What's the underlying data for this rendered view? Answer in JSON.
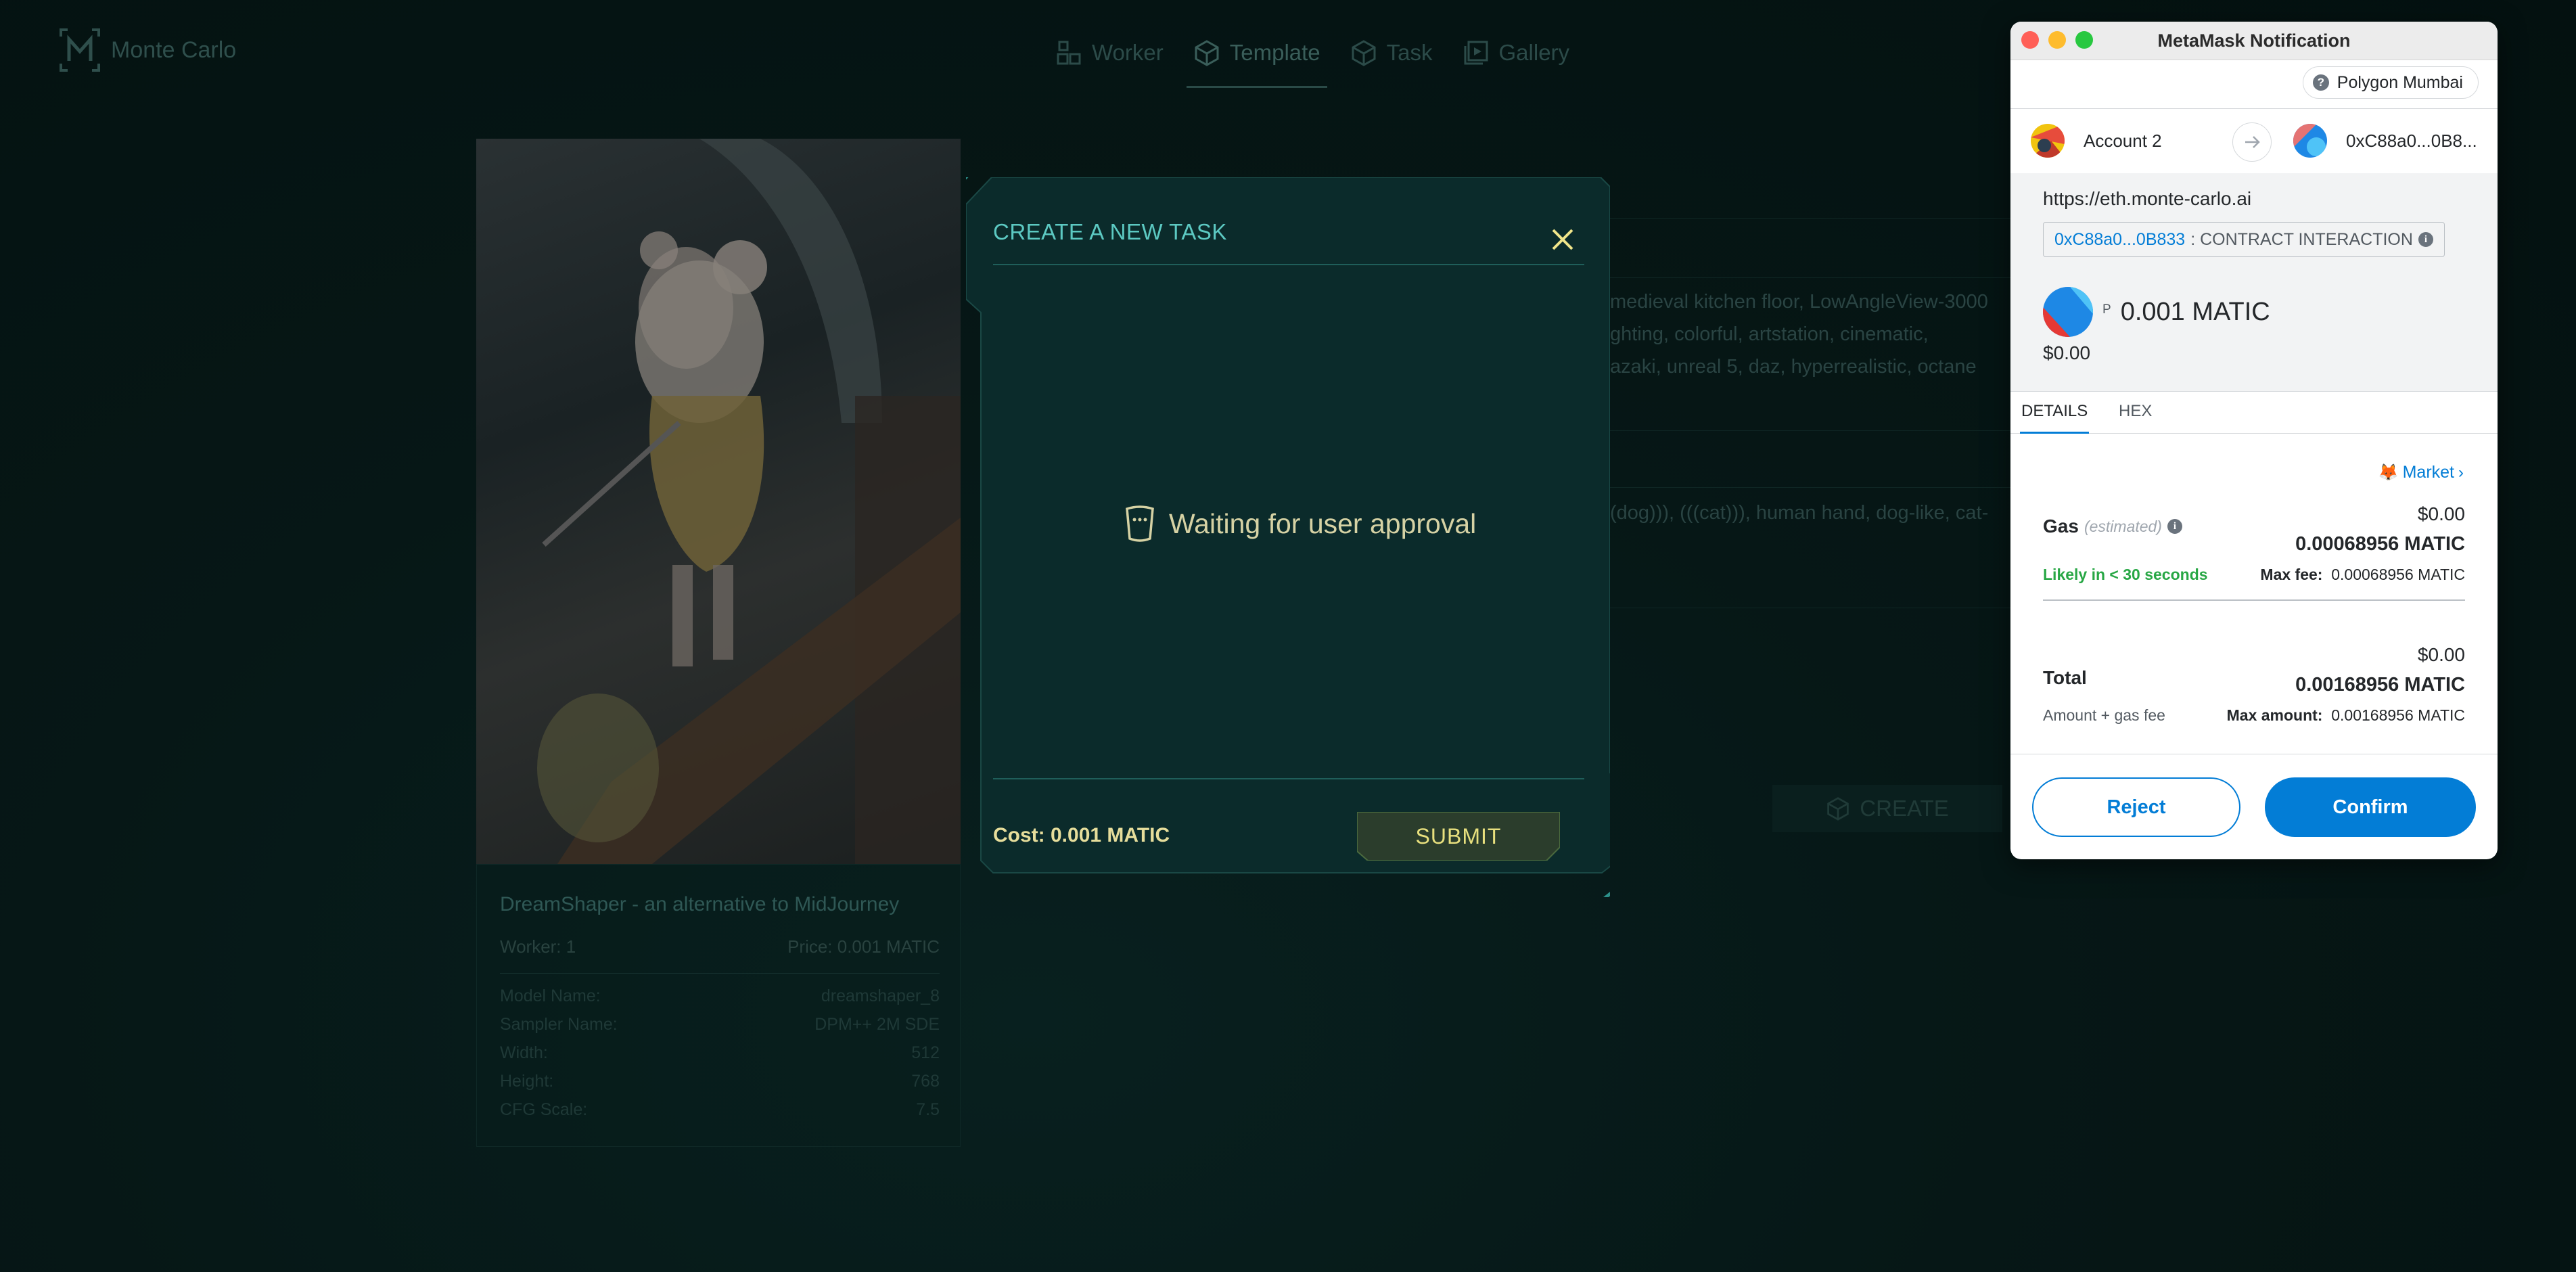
{
  "app": {
    "logo_text": "Monte Carlo",
    "nav": [
      {
        "label": "Worker",
        "icon": "worker-icon"
      },
      {
        "label": "Template",
        "icon": "cube-icon",
        "active": true
      },
      {
        "label": "Task",
        "icon": "cube-icon"
      },
      {
        "label": "Gallery",
        "icon": "gallery-icon"
      }
    ],
    "card": {
      "title": "DreamShaper - an alternative to MidJourney",
      "worker": "Worker: 1",
      "price": "Price: 0.001 MATIC",
      "specs": [
        {
          "label": "Model Name:",
          "value": "dreamshaper_8"
        },
        {
          "label": "Sampler Name:",
          "value": "DPM++ 2M SDE"
        },
        {
          "label": "Width:",
          "value": "512"
        },
        {
          "label": "Height:",
          "value": "768"
        },
        {
          "label": "CFG Scale:",
          "value": "7.5"
        }
      ]
    },
    "prompt_lines": [
      "medieval kitchen floor, LowAngleView-3000",
      "ghting, colorful, artstation, cinematic,",
      "azaki, unreal 5, daz, hyperrealistic, octane"
    ],
    "negative_line": "(dog))), (((cat))), human hand, dog-like, cat-",
    "create_label": "CREATE"
  },
  "modal": {
    "title": "CREATE A NEW TASK",
    "waiting_text": "Waiting for user approval",
    "cost": "Cost: 0.001 MATIC",
    "submit_label": "SUBMIT"
  },
  "metamask": {
    "window_title": "MetaMask Notification",
    "network": "Polygon Mumbai",
    "from_account": "Account 2",
    "to_account": "0xC88a0...0B8...",
    "origin": "https://eth.monte-carlo.ai",
    "contract_address": "0xC88a0...0B833",
    "contract_type": ": CONTRACT INTERACTION",
    "token_symbol_letter": "P",
    "amount": "0.001 MATIC",
    "amount_usd": "$0.00",
    "tabs": [
      "DETAILS",
      "HEX"
    ],
    "market_label": "Market",
    "gas": {
      "label": "Gas",
      "estimated": "(estimated)",
      "usd": "$0.00",
      "value": "0.00068956 MATIC",
      "likely": "Likely in < 30 seconds",
      "max_fee_label": "Max fee:",
      "max_fee_value": "0.00068956 MATIC"
    },
    "total": {
      "label": "Total",
      "usd": "$0.00",
      "value": "0.00168956 MATIC",
      "sub": "Amount + gas fee",
      "max_amount_label": "Max amount:",
      "max_amount_value": "0.00168956 MATIC"
    },
    "reject_label": "Reject",
    "confirm_label": "Confirm"
  }
}
